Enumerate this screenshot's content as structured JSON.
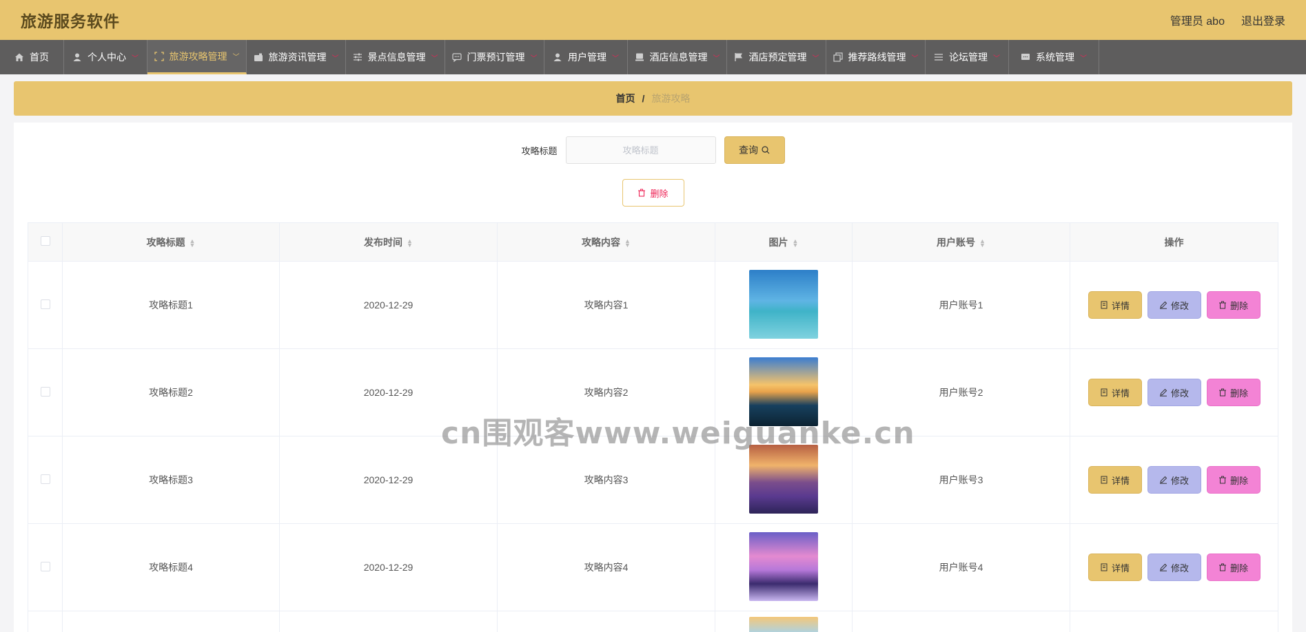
{
  "header": {
    "app_title": "旅游服务软件",
    "user_label": "管理员 abo",
    "logout_label": "退出登录"
  },
  "nav": {
    "items": [
      {
        "label": "首页",
        "icon": "home-icon",
        "has_menu": false
      },
      {
        "label": "个人中心",
        "icon": "user-icon",
        "has_menu": true
      },
      {
        "label": "旅游攻略管理",
        "icon": "fullscreen-icon",
        "has_menu": true,
        "active": true
      },
      {
        "label": "旅游资讯管理",
        "icon": "wallet-icon",
        "has_menu": true
      },
      {
        "label": "景点信息管理",
        "icon": "sliders-icon",
        "has_menu": true
      },
      {
        "label": "门票预订管理",
        "icon": "chat-icon",
        "has_menu": true
      },
      {
        "label": "用户管理",
        "icon": "user-icon",
        "has_menu": true
      },
      {
        "label": "酒店信息管理",
        "icon": "stack-icon",
        "has_menu": true
      },
      {
        "label": "酒店预定管理",
        "icon": "flag-icon",
        "has_menu": true
      },
      {
        "label": "推荐路线管理",
        "icon": "copy-icon",
        "has_menu": true
      },
      {
        "label": "论坛管理",
        "icon": "list-icon",
        "has_menu": true
      },
      {
        "label": "系统管理",
        "icon": "message-icon",
        "has_menu": true
      }
    ]
  },
  "breadcrumb": {
    "home": "首页",
    "separator": "/",
    "current": "旅游攻略"
  },
  "search": {
    "label": "攻略标题",
    "placeholder": "攻略标题",
    "value": "",
    "button_label": "查询"
  },
  "bulk_delete_label": "删除",
  "table": {
    "columns": [
      "攻略标题",
      "发布时间",
      "攻略内容",
      "图片",
      "用户账号",
      "操作"
    ],
    "rows": [
      {
        "title": "攻略标题1",
        "date": "2020-12-29",
        "content": "攻略内容1",
        "account": "用户账号1"
      },
      {
        "title": "攻略标题2",
        "date": "2020-12-29",
        "content": "攻略内容2",
        "account": "用户账号2"
      },
      {
        "title": "攻略标题3",
        "date": "2020-12-29",
        "content": "攻略内容3",
        "account": "用户账号3"
      },
      {
        "title": "攻略标题4",
        "date": "2020-12-29",
        "content": "攻略内容4",
        "account": "用户账号4"
      }
    ],
    "actions": {
      "detail": "详情",
      "edit": "修改",
      "delete": "删除"
    }
  },
  "watermark": "cn围观客www.weiguanke.cn",
  "colors": {
    "accent": "#e8c56f",
    "nav_bg": "#5e5d5d",
    "edit_btn": "#b5b8ec",
    "delete_btn": "#f383d5",
    "danger_text": "#ee2255"
  }
}
